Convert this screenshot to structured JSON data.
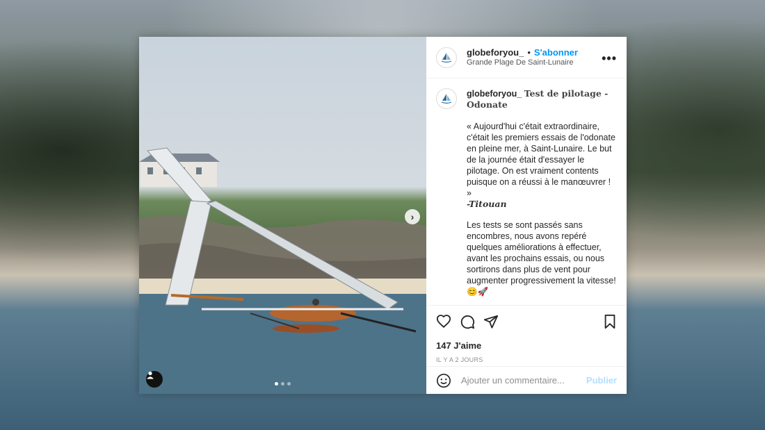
{
  "post": {
    "username": "globeforyou_",
    "separator": "•",
    "follow_label": "S'abonner",
    "location": "Grande Plage De Saint-Lunaire",
    "more_label": "•••",
    "caption_username": "globeforyou_",
    "caption_title": "Test de pilotage - Odonate",
    "caption_text": "« Aujourd'hui c'était extraordinaire, c'était les premiers essais de l'odonate en pleine mer, à Saint-Lunaire. Le but de la journée était d'essayer le pilotage. On est vraiment contents puisque on a réussi à le manœuvrer ! »",
    "caption_signature": "-Titouan",
    "caption_text2": "Les tests se sont passés sans encombres, nous avons repéré quelques améliorations à effectuer, avant les prochains essais, ou nous sortirons dans plus de vent pour augmenter progressivement la vitesse! 😊🚀",
    "likes": "147 J'aime",
    "date": "IL Y A 2 JOURS"
  },
  "comment_box": {
    "placeholder": "Ajouter un commentaire...",
    "publish_label": "Publier"
  },
  "carousel": {
    "total": 3,
    "active": 1
  },
  "colors": {
    "accent": "#0095f6",
    "publish_disabled": "#b2dffc"
  }
}
